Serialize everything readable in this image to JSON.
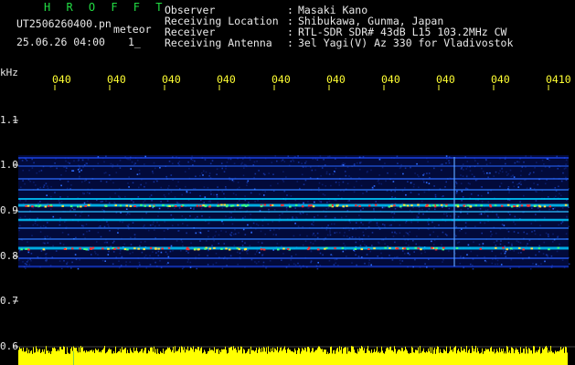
{
  "header": {
    "brand": "H R O F F T",
    "filename": "UT2506260400.pn",
    "mode": "meteor",
    "datetime": "25.06.26 04:00",
    "counter": "1_",
    "fields": [
      {
        "label": "Observer",
        "value": "Masaki Kano"
      },
      {
        "label": "Receiving Location",
        "value": "Shibukawa, Gunma, Japan"
      },
      {
        "label": "Receiver",
        "value": "RTL-SDR SDR# 43dB L15 103.2MHz CW"
      },
      {
        "label": "Receiving Antenna",
        "value": "3el Yagi(V) Az 330 for Vladivostok"
      }
    ]
  },
  "time_axis": {
    "labels": [
      "040",
      "040",
      "040",
      "040",
      "040",
      "040",
      "040",
      "040",
      "040",
      "0410"
    ]
  },
  "freq_axis": {
    "unit": "kHz",
    "labels": [
      "1.1",
      "1.0",
      "0.9",
      "0.8",
      "0.7",
      "0.6"
    ]
  },
  "colors": {
    "background": "#000000",
    "text": "#e8e8e8",
    "brand": "#22dd44",
    "axis": "#ffff33",
    "signal_low": "#0a1a8a",
    "signal_mid": "#00c8ff",
    "signal_high": "#ff3030",
    "level_bar": "#ffff00"
  }
}
